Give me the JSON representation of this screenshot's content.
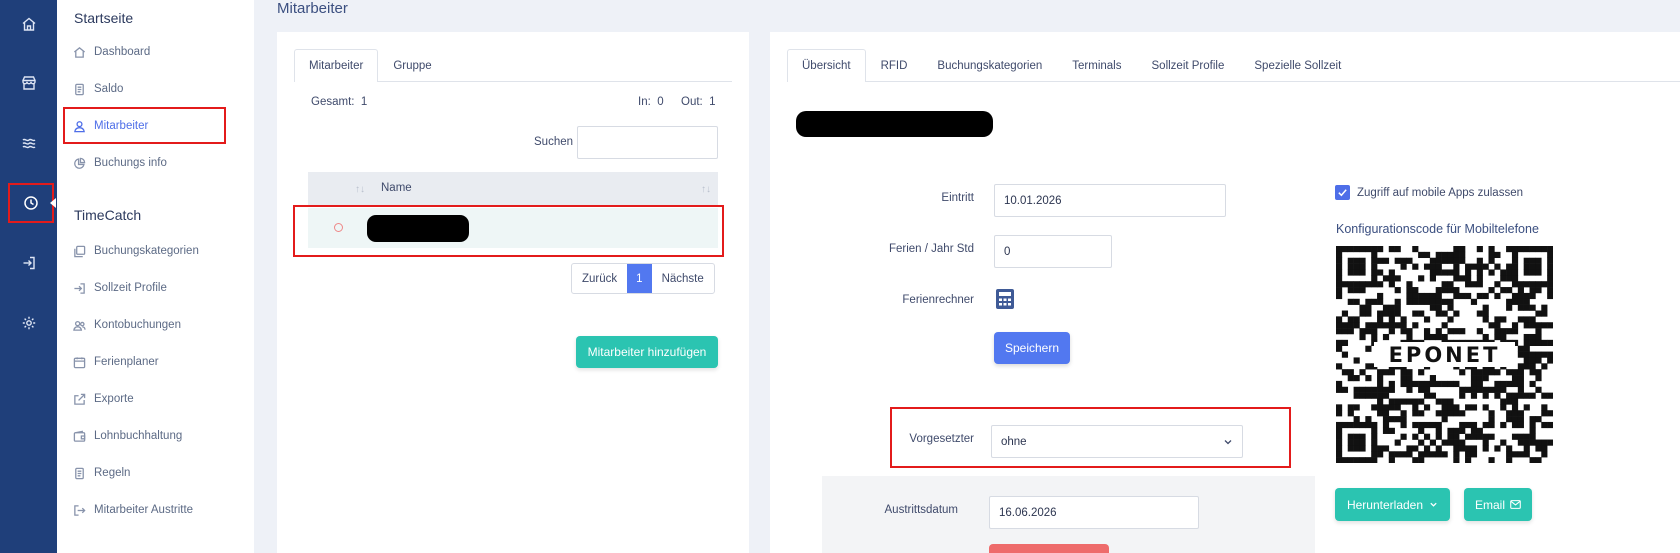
{
  "rail": {
    "icons": [
      "home-icon",
      "store-icon",
      "waves-icon",
      "clock-icon",
      "login-icon",
      "gear-icon"
    ]
  },
  "sidebar": {
    "section1_title": "Startseite",
    "section1_items": [
      {
        "label": "Dashboard",
        "icon": "home-icon"
      },
      {
        "label": "Saldo",
        "icon": "document-icon"
      },
      {
        "label": "Mitarbeiter",
        "icon": "user-icon"
      },
      {
        "label": "Buchungs info",
        "icon": "pie-chart-icon"
      }
    ],
    "section2_title": "TimeCatch",
    "section2_items": [
      {
        "label": "Buchungskategorien",
        "icon": "copy-icon"
      },
      {
        "label": "Sollzeit Profile",
        "icon": "login-icon"
      },
      {
        "label": "Kontobuchungen",
        "icon": "users-icon"
      },
      {
        "label": "Ferienplaner",
        "icon": "calendar-icon"
      },
      {
        "label": "Exporte",
        "icon": "share-icon"
      },
      {
        "label": "Lohnbuchhaltung",
        "icon": "wallet-icon"
      },
      {
        "label": "Regeln",
        "icon": "document-icon"
      },
      {
        "label": "Mitarbeiter Austritte",
        "icon": "logout-icon"
      }
    ]
  },
  "page_title": "Mitarbeiter",
  "left": {
    "tabs": [
      "Mitarbeiter",
      "Gruppe"
    ],
    "gesamt_label": "Gesamt:",
    "gesamt_value": "1",
    "in_label": "In:",
    "in_value": "0",
    "out_label": "Out:",
    "out_value": "1",
    "search_label": "Suchen",
    "search_value": "",
    "column_name": "Name",
    "pager": {
      "prev": "Zurück",
      "current": "1",
      "next": "Nächste"
    },
    "add_button": "Mitarbeiter hinzufügen"
  },
  "right": {
    "tabs": [
      "Übersicht",
      "RFID",
      "Buchungskategorien",
      "Terminals",
      "Sollzeit Profile",
      "Spezielle Sollzeit"
    ],
    "eintritt_label": "Eintritt",
    "eintritt_value": "10.01.2026",
    "ferien_label": "Ferien / Jahr Std",
    "ferien_value": "0",
    "ferienrechner_label": "Ferienrechner",
    "save_button": "Speichern",
    "vorgesetzter_label": "Vorgesetzter",
    "vorgesetzter_value": "ohne",
    "austritt_label": "Austrittsdatum",
    "austritt_value": "16.06.2026",
    "mobile_checkbox_label": "Zugriff auf mobile Apps zulassen",
    "mobile_checkbox_checked": true,
    "qr_title": "Konfigurationscode für Mobiltelefone",
    "qr_brand_text": "EPONET",
    "download_button": "Herunterladen",
    "email_button": "Email"
  },
  "colors": {
    "rail": "#1f3f7a",
    "accent_blue": "#5278f0",
    "teal": "#2bc4b1",
    "highlight_red": "#e31b1b"
  }
}
